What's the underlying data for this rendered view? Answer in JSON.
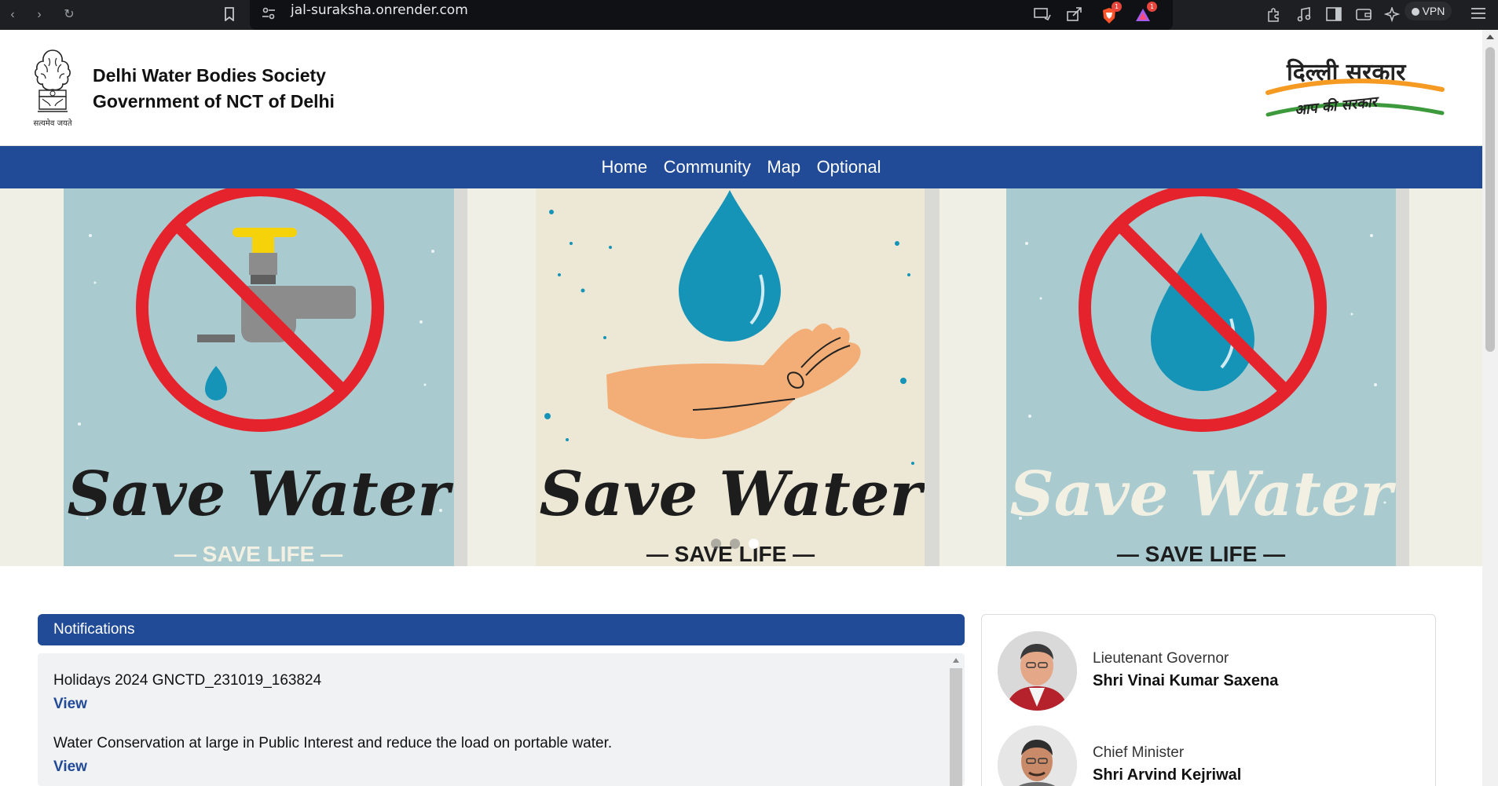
{
  "browser": {
    "url": "jal-suraksha.onrender.com",
    "brave_badge": "1",
    "rewards_badge": "1",
    "vpn_label": "VPN"
  },
  "header": {
    "org_line1": "Delhi Water Bodies Society",
    "org_line2": "Government of NCT of Delhi",
    "emblem_motto": "सत्यमेव जयते",
    "logo_line1": "दिल्ली सरकार",
    "logo_line2": "आप की सरकार"
  },
  "nav": {
    "items": [
      "Home",
      "Community",
      "Map",
      "Optional"
    ]
  },
  "carousel": {
    "slides": [
      {
        "title": "Save Water",
        "subtitle": "— SAVE LIFE —"
      },
      {
        "title": "Save Water",
        "subtitle": "— SAVE LIFE —"
      },
      {
        "title": "Save Water",
        "subtitle": "— SAVE LIFE —"
      }
    ],
    "active_index": 2,
    "indicator_count": 3
  },
  "notifications": {
    "title": "Notifications",
    "items": [
      {
        "text": "Holidays 2024 GNCTD_231019_163824",
        "link": "View"
      },
      {
        "text": "Water Conservation at large in Public Interest and reduce the load on portable water.",
        "link": "View"
      }
    ]
  },
  "dignitaries": [
    {
      "role": "Lieutenant Governor",
      "name": "Shri Vinai Kumar Saxena"
    },
    {
      "role": "Chief Minister",
      "name": "Shri Arvind Kejriwal"
    }
  ],
  "colors": {
    "primary_blue": "#214b97",
    "no_sign_red": "#e5232d",
    "water_blue": "#1594b8",
    "poster_blue_bg": "#a9cbd0",
    "poster_cream_bg": "#ede8d6"
  }
}
